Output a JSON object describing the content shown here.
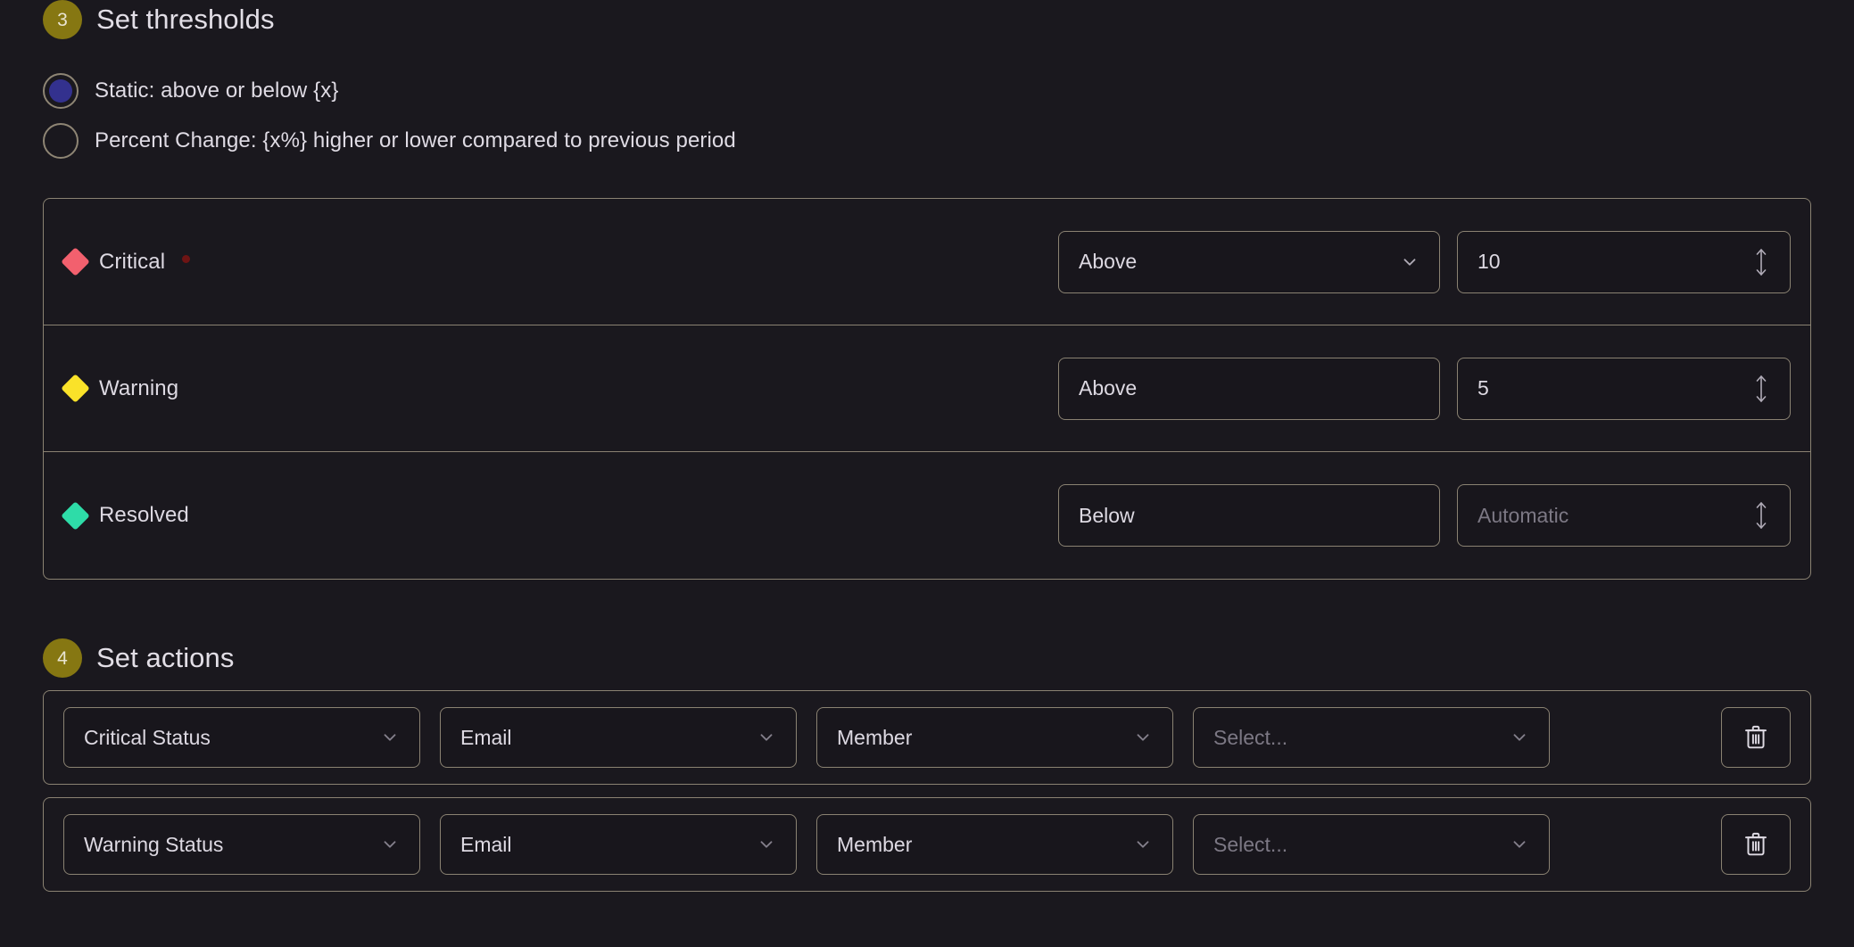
{
  "thresholds_section": {
    "step": "3",
    "title": "Set thresholds",
    "threshold_type_options": [
      {
        "label": "Static: above or below {x}",
        "selected": true
      },
      {
        "label": "Percent Change: {x%} higher or lower compared to previous period",
        "selected": false
      }
    ],
    "rows": [
      {
        "name": "Critical",
        "color": "#F2606E",
        "required": true,
        "comparison": "Above",
        "comparison_has_chevron": true,
        "value": "10",
        "value_is_placeholder": false
      },
      {
        "name": "Warning",
        "color": "#FAE229",
        "required": false,
        "comparison": "Above",
        "comparison_has_chevron": false,
        "value": "5",
        "value_is_placeholder": false
      },
      {
        "name": "Resolved",
        "color": "#2EDCA8",
        "required": false,
        "comparison": "Below",
        "comparison_has_chevron": false,
        "value": "Automatic",
        "value_is_placeholder": true
      }
    ]
  },
  "actions_section": {
    "step": "4",
    "title": "Set actions",
    "rows": [
      {
        "trigger": "Critical Status",
        "channel": "Email",
        "target_type": "Member",
        "target": "Select...",
        "target_is_placeholder": true,
        "delete_icon": "trash-icon"
      },
      {
        "trigger": "Warning Status",
        "channel": "Email",
        "target_type": "Member",
        "target": "Select...",
        "target_is_placeholder": true,
        "delete_icon": "trash-icon"
      }
    ]
  },
  "colors": {
    "background": "#1A181E",
    "border": "#8A8272",
    "step_badge": "#867712",
    "radio_selected": "#33318E",
    "text": "#DDD9E2",
    "placeholder": "#7C7884",
    "required_dot": "#6E1414"
  }
}
